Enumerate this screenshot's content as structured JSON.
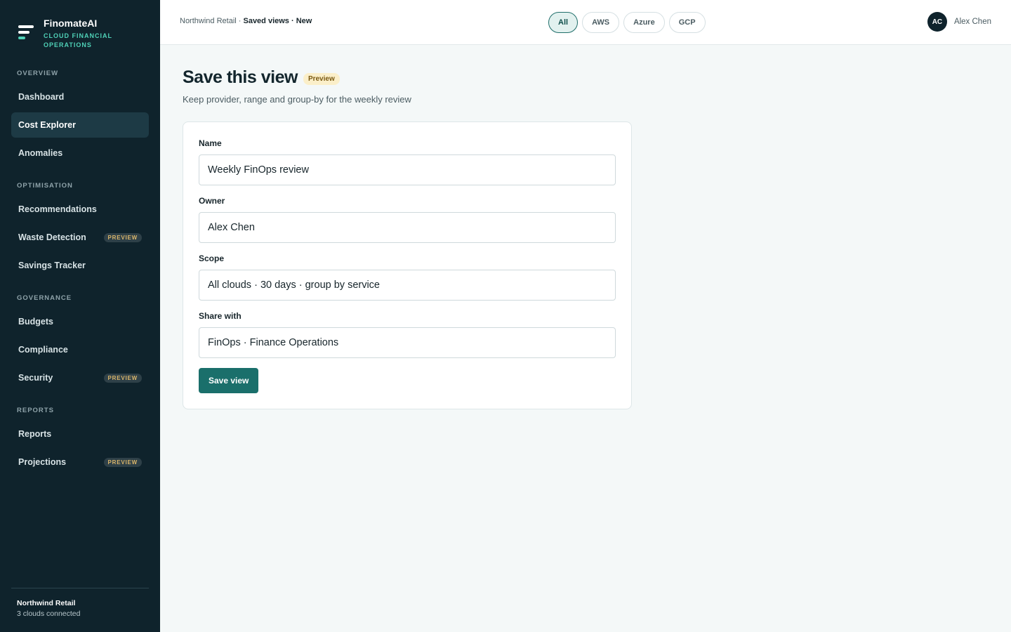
{
  "brand": {
    "name": "FinomateAI",
    "tagline": "CLOUD FINANCIAL OPERATIONS",
    "icon": "finomate-logo-icon"
  },
  "sidebar": {
    "sections": [
      {
        "label": "OVERVIEW"
      },
      {
        "label": "OPTIMISATION"
      },
      {
        "label": "GOVERNANCE"
      },
      {
        "label": "REPORTS"
      }
    ],
    "items": [
      {
        "label": "Dashboard"
      },
      {
        "label": "Cost Explorer",
        "active": true
      },
      {
        "label": "Anomalies"
      },
      {
        "label": "Recommendations"
      },
      {
        "label": "Waste Detection",
        "badge": "PREVIEW"
      },
      {
        "label": "Savings Tracker"
      },
      {
        "label": "Budgets"
      },
      {
        "label": "Compliance"
      },
      {
        "label": "Security",
        "badge": "PREVIEW"
      },
      {
        "label": "Reports"
      },
      {
        "label": "Projections",
        "badge": "PREVIEW"
      }
    ],
    "footer": {
      "org": "Northwind Retail",
      "status": "3 clouds connected"
    }
  },
  "header": {
    "breadcrumb_prefix": "Northwind Retail · ",
    "breadcrumb_current": "Saved views · New",
    "filters": [
      {
        "label": "All",
        "active": true
      },
      {
        "label": "AWS"
      },
      {
        "label": "Azure"
      },
      {
        "label": "GCP"
      }
    ],
    "user": {
      "initials": "AC",
      "name": "Alex Chen"
    }
  },
  "main": {
    "title": "Save this view",
    "badge": "Preview",
    "subtitle": "Keep provider, range and group-by for the weekly review",
    "form": {
      "fields": [
        {
          "label": "Name",
          "value": "Weekly FinOps review"
        },
        {
          "label": "Owner",
          "value": "Alex Chen"
        },
        {
          "label": "Scope",
          "value": "All clouds · 30 days · group by service"
        },
        {
          "label": "Share with",
          "value": "FinOps · Finance Operations"
        }
      ],
      "submit_label": "Save view"
    }
  },
  "colors": {
    "sidebar_bg": "#0f232c",
    "accent": "#1a6f6b",
    "brand_accent": "#4fd1b7",
    "preview_badge": "#fbefc9"
  }
}
